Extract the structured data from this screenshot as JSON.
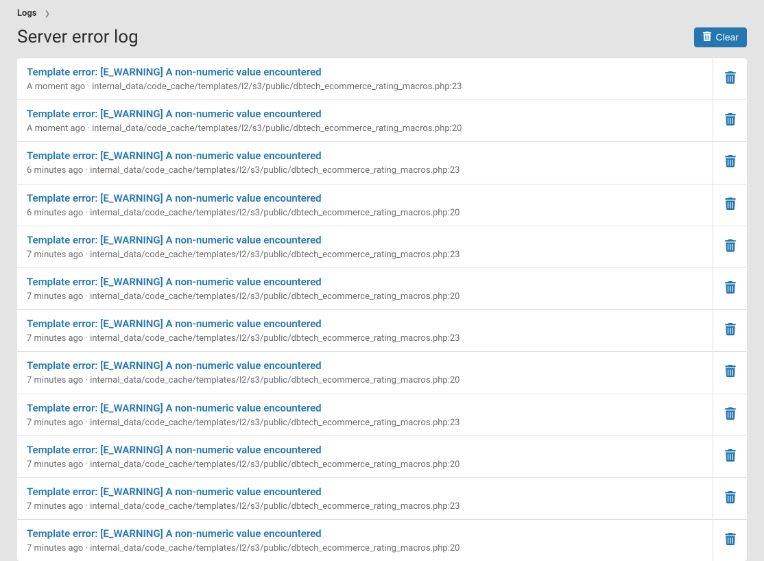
{
  "breadcrumb": {
    "root_label": "Logs"
  },
  "page": {
    "title": "Server error log"
  },
  "actions": {
    "clear_label": "Clear"
  },
  "logs": [
    {
      "title": "Template error: [E_WARNING] A non-numeric value encountered",
      "time": "A moment ago",
      "path": "internal_data/code_cache/templates/l2/s3/public/dbtech_ecommerce_rating_macros.php:23"
    },
    {
      "title": "Template error: [E_WARNING] A non-numeric value encountered",
      "time": "A moment ago",
      "path": "internal_data/code_cache/templates/l2/s3/public/dbtech_ecommerce_rating_macros.php:20"
    },
    {
      "title": "Template error: [E_WARNING] A non-numeric value encountered",
      "time": "6 minutes ago",
      "path": "internal_data/code_cache/templates/l2/s3/public/dbtech_ecommerce_rating_macros.php:23"
    },
    {
      "title": "Template error: [E_WARNING] A non-numeric value encountered",
      "time": "6 minutes ago",
      "path": "internal_data/code_cache/templates/l2/s3/public/dbtech_ecommerce_rating_macros.php:20"
    },
    {
      "title": "Template error: [E_WARNING] A non-numeric value encountered",
      "time": "7 minutes ago",
      "path": "internal_data/code_cache/templates/l2/s3/public/dbtech_ecommerce_rating_macros.php:23"
    },
    {
      "title": "Template error: [E_WARNING] A non-numeric value encountered",
      "time": "7 minutes ago",
      "path": "internal_data/code_cache/templates/l2/s3/public/dbtech_ecommerce_rating_macros.php:20"
    },
    {
      "title": "Template error: [E_WARNING] A non-numeric value encountered",
      "time": "7 minutes ago",
      "path": "internal_data/code_cache/templates/l2/s3/public/dbtech_ecommerce_rating_macros.php:23"
    },
    {
      "title": "Template error: [E_WARNING] A non-numeric value encountered",
      "time": "7 minutes ago",
      "path": "internal_data/code_cache/templates/l2/s3/public/dbtech_ecommerce_rating_macros.php:20"
    },
    {
      "title": "Template error: [E_WARNING] A non-numeric value encountered",
      "time": "7 minutes ago",
      "path": "internal_data/code_cache/templates/l2/s3/public/dbtech_ecommerce_rating_macros.php:23"
    },
    {
      "title": "Template error: [E_WARNING] A non-numeric value encountered",
      "time": "7 minutes ago",
      "path": "internal_data/code_cache/templates/l2/s3/public/dbtech_ecommerce_rating_macros.php:20"
    },
    {
      "title": "Template error: [E_WARNING] A non-numeric value encountered",
      "time": "7 minutes ago",
      "path": "internal_data/code_cache/templates/l2/s3/public/dbtech_ecommerce_rating_macros.php:23"
    },
    {
      "title": "Template error: [E_WARNING] A non-numeric value encountered",
      "time": "7 minutes ago",
      "path": "internal_data/code_cache/templates/l2/s3/public/dbtech_ecommerce_rating_macros.php:20"
    }
  ]
}
